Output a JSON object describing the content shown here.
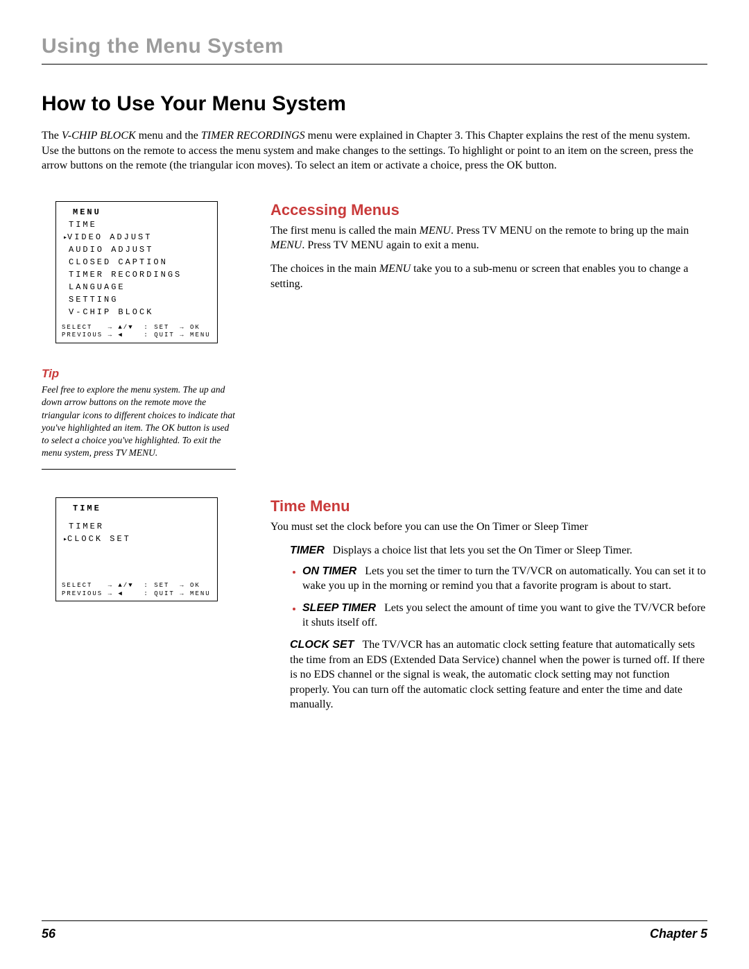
{
  "header": {
    "title": "Using the Menu System"
  },
  "section1": {
    "title": "How to Use Your Menu System",
    "intro_html": "The <em class='it'>V-CHIP BLOCK</em> menu and the <em class='it'>TIMER RECORDINGS</em> menu were explained in Chapter 3. This Chapter explains the rest of the menu system. Use the buttons on the remote to access the menu system and make changes to the settings. To highlight or point to an item on the screen, press the arrow buttons on the remote (the triangular icon moves). To select an item or activate a choice, press the OK button."
  },
  "osd_main": {
    "title": "MENU",
    "items": [
      {
        "label": "TIME",
        "selected": false
      },
      {
        "label": "VIDEO ADJUST",
        "selected": true
      },
      {
        "label": "AUDIO ADJUST",
        "selected": false
      },
      {
        "label": "CLOSED CAPTION",
        "selected": false
      },
      {
        "label": "TIMER RECORDINGS",
        "selected": false
      },
      {
        "label": "LANGUAGE",
        "selected": false
      },
      {
        "label": "SETTING",
        "selected": false
      },
      {
        "label": "V-CHIP BLOCK",
        "selected": false
      }
    ],
    "footer_line1": "SELECT   → ▲/▼  : SET  → OK",
    "footer_line2": "PREVIOUS → ◀    : QUIT → MENU"
  },
  "accessing": {
    "heading": "Accessing Menus",
    "p1_html": "The first menu is called the main <em class='it'>MENU</em>. Press TV MENU on the remote to bring up the main <em class='it'>MENU</em>. Press TV MENU again to exit a menu.",
    "p2_html": "The choices in the main <em class='it'>MENU</em> take you to a sub-menu or screen that enables you to change a setting."
  },
  "tip": {
    "heading": "Tip",
    "body": "Feel free to explore the menu system. The up and down arrow buttons on the remote move the triangular icons to different choices to indicate that you've highlighted an item. The OK button is used to select a choice you've highlighted. To exit the menu system, press TV MENU."
  },
  "osd_time": {
    "title": "TIME",
    "items": [
      {
        "label": "TIMER",
        "selected": false
      },
      {
        "label": "CLOCK SET",
        "selected": true
      }
    ],
    "footer_line1": "SELECT   → ▲/▼  : SET  → OK",
    "footer_line2": "PREVIOUS → ◀    : QUIT → MENU"
  },
  "time_menu": {
    "heading": "Time Menu",
    "intro": "You must set the clock before you can use the On Timer or Sleep Timer",
    "timer": {
      "label": "TIMER",
      "desc": "Displays a choice list that lets you set the On Timer or Sleep Timer.",
      "bullets": [
        {
          "label": "ON TIMER",
          "text": "Lets you set the timer to turn the TV/VCR on automatically. You can set it to wake you up in the morning or remind you that a favorite program is about to start."
        },
        {
          "label": "SLEEP TIMER",
          "text": "Lets you select the amount of time you want to give the TV/VCR before it shuts itself off."
        }
      ]
    },
    "clock_set": {
      "label": "CLOCK SET",
      "desc": "The TV/VCR has an automatic clock setting feature that automatically sets the time from an EDS (Extended Data Service) channel when the power is turned off. If there is no EDS channel or the signal is weak, the automatic clock setting may not function properly. You can turn off the automatic clock setting feature and enter the time and date manually."
    }
  },
  "footer": {
    "page": "56",
    "chapter": "Chapter 5"
  }
}
